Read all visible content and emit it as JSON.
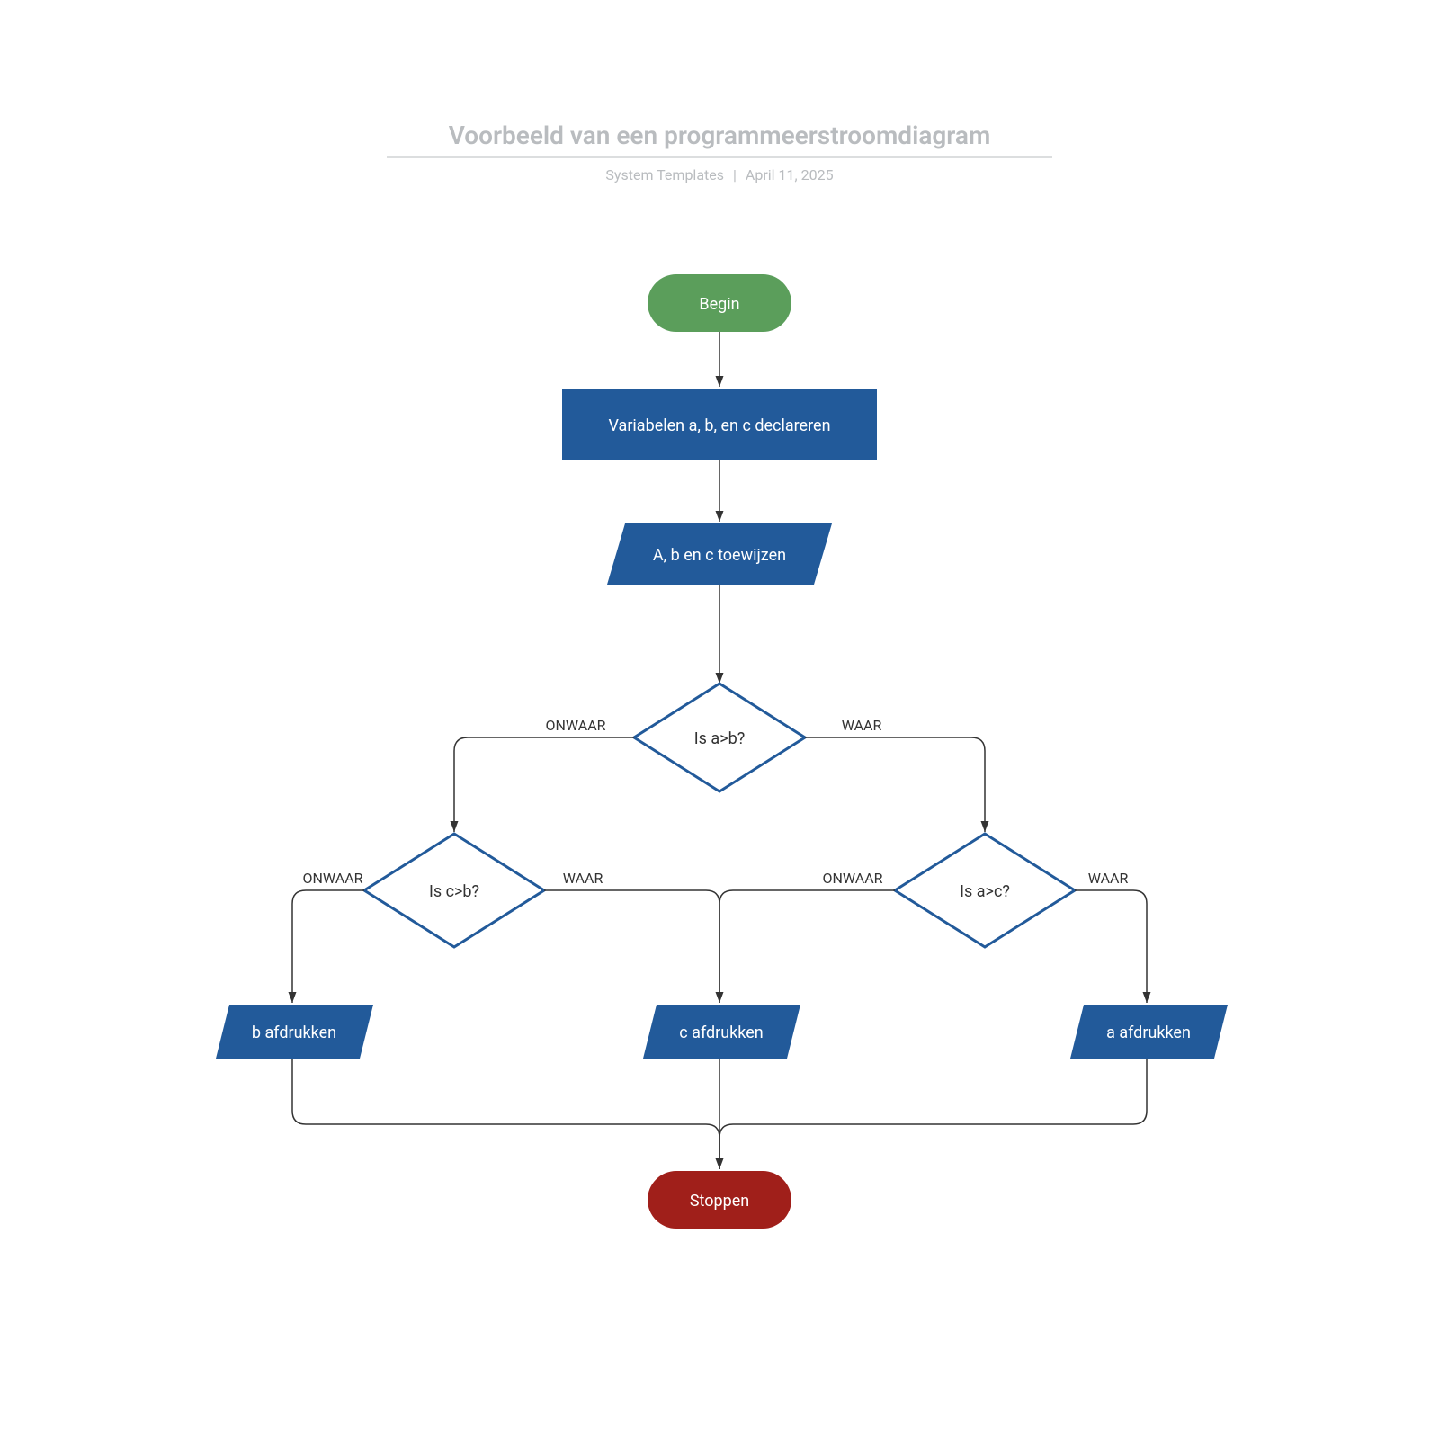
{
  "header": {
    "title": "Voorbeeld van een programmeerstroomdiagram",
    "author": "System Templates",
    "date": "April 11, 2025"
  },
  "nodes": {
    "begin": "Begin",
    "declare": "Variabelen a, b, en c declareren",
    "assign": "A, b en c toewijzen",
    "dec_ab": "Is a>b?",
    "dec_cb": "Is c>b?",
    "dec_ac": "Is a>c?",
    "print_b": "b afdrukken",
    "print_c": "c afdrukken",
    "print_a": "a afdrukken",
    "stop": "Stoppen"
  },
  "labels": {
    "true": "WAAR",
    "false": "ONWAAR"
  }
}
